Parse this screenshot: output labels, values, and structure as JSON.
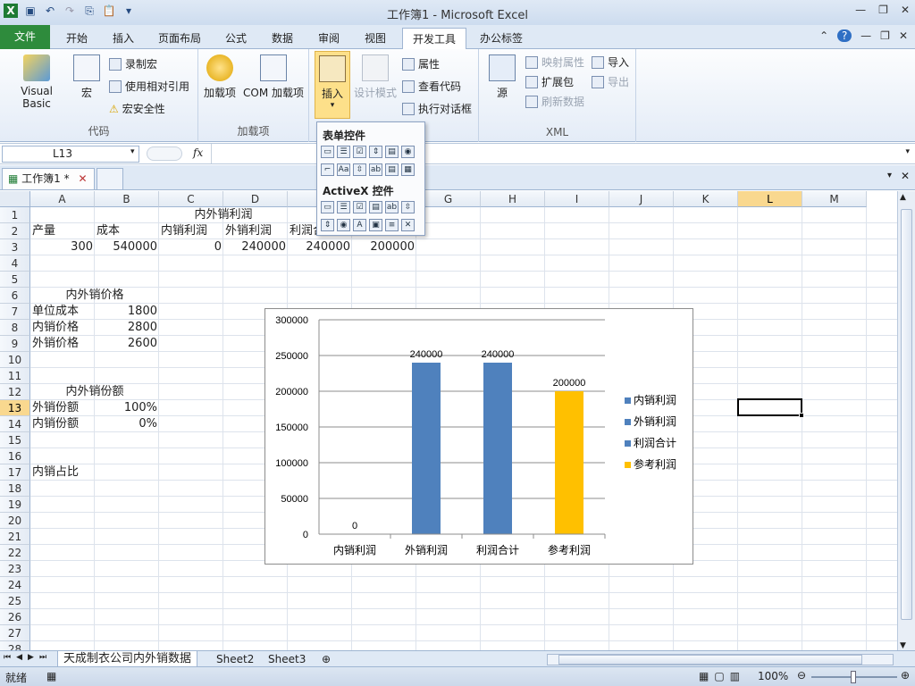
{
  "window": {
    "title": "工作簿1 - Microsoft Excel"
  },
  "ribbon_tabs": [
    "文件",
    "开始",
    "插入",
    "页面布局",
    "公式",
    "数据",
    "审阅",
    "视图",
    "开发工具",
    "办公标签"
  ],
  "ribbon": {
    "code_group": {
      "label": "代码",
      "visual_basic": "Visual Basic",
      "macro": "宏",
      "record_macro": "录制宏",
      "relative_ref": "使用相对引用",
      "macro_security": "宏安全性"
    },
    "addins_group": {
      "label": "加载项",
      "addins": "加载项",
      "com_addins": "COM 加载项"
    },
    "controls_group": {
      "insert": "插入",
      "design_mode": "设计模式",
      "properties": "属性",
      "view_code": "查看代码",
      "run_dialog": "执行对话框"
    },
    "xml_group": {
      "label": "XML",
      "source": "源",
      "map_props": "映射属性",
      "expansion": "扩展包",
      "refresh": "刷新数据",
      "import": "导入",
      "export": "导出"
    }
  },
  "dropdown": {
    "form_controls": "表单控件",
    "activex_controls": "ActiveX 控件"
  },
  "formula_bar": {
    "name_box": "L13",
    "fx": "fx",
    "value": ""
  },
  "doc_tab": {
    "label": "工作簿1 *"
  },
  "columns": [
    "A",
    "B",
    "C",
    "D",
    "E",
    "F",
    "G",
    "H",
    "I",
    "J",
    "K",
    "L",
    "M"
  ],
  "rows": [
    "1",
    "2",
    "3",
    "4",
    "5",
    "6",
    "7",
    "8",
    "9",
    "10",
    "11",
    "12",
    "13",
    "14",
    "15",
    "16",
    "17",
    "18",
    "19",
    "20",
    "21",
    "22",
    "23",
    "24",
    "25",
    "26",
    "27",
    "28"
  ],
  "cells": {
    "r1_title": "内外销利润",
    "r2": [
      "产量",
      "成本",
      "内销利润",
      "外销利润",
      "利润合计",
      "参考利润"
    ],
    "r3": [
      "300",
      "540000",
      "0",
      "240000",
      "240000",
      "200000"
    ],
    "r6_title": "内外销价格",
    "r7": [
      "单位成本",
      "1800"
    ],
    "r8": [
      "内销价格",
      "2800"
    ],
    "r9": [
      "外销价格",
      "2600"
    ],
    "r12_title": "内外销份额",
    "r13": [
      "外销份额",
      "100%"
    ],
    "r14": [
      "内销份额",
      "0%"
    ],
    "r17": [
      "内销占比"
    ]
  },
  "chart_data": {
    "type": "bar",
    "categories": [
      "内销利润",
      "外销利润",
      "利润合计",
      "参考利润"
    ],
    "values": [
      0,
      240000,
      240000,
      200000
    ],
    "data_labels": [
      "0",
      "240000",
      "240000",
      "200000"
    ],
    "colors": [
      "#4f81bd",
      "#4f81bd",
      "#4f81bd",
      "#ffc000"
    ],
    "ylim": [
      0,
      300000
    ],
    "yticks": [
      "0",
      "50000",
      "100000",
      "150000",
      "200000",
      "250000",
      "300000"
    ],
    "legend": [
      "内销利润",
      "外销利润",
      "利润合计",
      "参考利润"
    ],
    "legend_colors": [
      "#4f81bd",
      "#4f81bd",
      "#4f81bd",
      "#ffc000"
    ],
    "legend_position": "right",
    "grid": true
  },
  "sheet_tabs": [
    "天成制衣公司内外销数据",
    "Sheet2",
    "Sheet3"
  ],
  "status": {
    "ready": "就绪",
    "zoom": "100%"
  }
}
